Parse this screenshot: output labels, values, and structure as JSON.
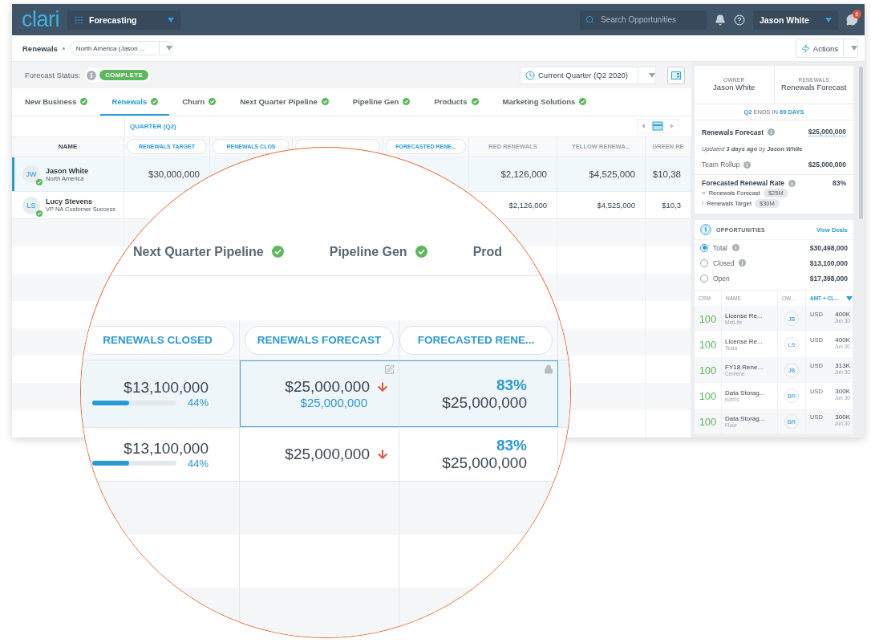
{
  "app": {
    "logo": "clari",
    "module": "Forecasting",
    "search": {
      "placeholder": "Search Opportunities"
    },
    "user": "Jason White",
    "notifications": "6"
  },
  "toolbar": {
    "title": "Renewals",
    "scope": "North America (Jason ...",
    "actions": "Actions"
  },
  "status": {
    "label": "Forecast Status:",
    "badge": "COMPLETE",
    "period": "Current Quarter (Q2 2020)"
  },
  "tabs": [
    {
      "label": "New Business",
      "selected": false,
      "complete": true
    },
    {
      "label": "Renewals",
      "selected": true,
      "complete": true
    },
    {
      "label": "Churn",
      "selected": false,
      "complete": true
    },
    {
      "label": "Next Quarter Pipeline",
      "selected": false,
      "complete": true
    },
    {
      "label": "Pipeline Gen",
      "selected": false,
      "complete": true
    },
    {
      "label": "Products",
      "selected": false,
      "complete": true
    },
    {
      "label": "Marketing Solutions",
      "selected": false,
      "complete": true
    }
  ],
  "table": {
    "group": "QUARTER (Q2)",
    "name_header": "NAME",
    "columns": [
      {
        "kind": "pill",
        "label": "RENEWALS TARGET"
      },
      {
        "kind": "pill",
        "label": "RENEWALS CLOS"
      },
      {
        "kind": "pill"
      },
      {
        "kind": "pill",
        "label": "FORECASTED RENE..."
      },
      {
        "kind": "plain",
        "label": "RED RENEWALS"
      },
      {
        "kind": "plain",
        "label": "YELLOW RENEWA..."
      },
      {
        "kind": "plain",
        "label": "GREEN RE"
      }
    ],
    "rows": [
      {
        "initials": "JW",
        "name": "Jason White",
        "subtitle": "North America",
        "selected": true,
        "cells": [
          "$30,000,000",
          null,
          null,
          null,
          "$2,126,000",
          "$4,525,000",
          "$10,38"
        ]
      },
      {
        "initials": "LS",
        "name": "Lucy Stevens",
        "subtitle": "VP NA Customer Success",
        "selected": false,
        "cells": [
          null,
          null,
          null,
          null,
          "$2,126,000",
          "$4,525,000",
          "$10,3"
        ]
      }
    ]
  },
  "magnifier": {
    "tabs": [
      {
        "label": "Next Quarter Pipeline",
        "complete": true
      },
      {
        "label": "Pipeline Gen",
        "complete": true
      },
      {
        "label": "Prod",
        "complete": false
      }
    ],
    "columns": [
      "RENEWALS CLOSED",
      "RENEWALS FORECAST",
      "FORECASTED RENE..."
    ],
    "rows": [
      {
        "selected": true,
        "closed": "$13,100,000",
        "level": 0.44,
        "pct": "44%",
        "forecast": "$25,000,000",
        "falling": true,
        "forecast_sub": "$25,000,000",
        "rate": "83%",
        "rate_sub": "$25,000,000"
      },
      {
        "selected": false,
        "closed": "$13,100,000",
        "level": 0.44,
        "pct": "44%",
        "forecast": "$25,000,000",
        "falling": true,
        "rate": "83%",
        "rate_sub": "$25,000,000"
      }
    ]
  },
  "summary": {
    "owner_label": "OWNER",
    "owner": "Jason White",
    "type_label": "RENEWALS",
    "type": "Renewals Forecast",
    "countdown": "**Q2** ENDS IN **69 DAYS**",
    "forecast_label": "Renewals Forecast",
    "forecast": "$25,000,000",
    "updated": "Updated **3 days ago** by **Jason White**",
    "rollup_label": "Team Rollup",
    "rollup": "$25,000,000",
    "rate_label": "Forecasted Renewal Rate",
    "rate": "83%",
    "terms": [
      {
        "kind": "equals",
        "op": "=",
        "label": "Renewals Forecast",
        "chip": "$25M"
      },
      {
        "kind": "divide",
        "op": "/",
        "label": "Renewals Target",
        "chip": "$30M"
      }
    ]
  },
  "opportunities": {
    "title": "OPPORTUNITIES",
    "link": "View Deals",
    "filters": [
      {
        "label": "Total",
        "info": true,
        "value": "$30,498,000",
        "selected": true
      },
      {
        "label": "Closed",
        "info": true,
        "value": "$13,100,000",
        "selected": false
      },
      {
        "label": "Open",
        "value": "$17,398,000",
        "selected": false
      }
    ],
    "columns": [
      "CRM",
      "NAME",
      "OW...",
      "AMT + CL..."
    ],
    "deals": [
      {
        "score": "100",
        "name": "License Re...",
        "account": "MetLife",
        "owner": "JB",
        "currency": "USD",
        "amount": "400K",
        "date": "Jun 30"
      },
      {
        "score": "100",
        "name": "License Re...",
        "account": "Tesla",
        "owner": "LS",
        "currency": "USD",
        "amount": "400K",
        "date": "Jun 30"
      },
      {
        "score": "100",
        "name": "FY18 Rene...",
        "account": "Centene",
        "owner": "JB",
        "currency": "USD",
        "amount": "313K",
        "date": "Jun 30"
      },
      {
        "score": "100",
        "name": "Data Storag...",
        "account": "Kohl's",
        "owner": "BR",
        "currency": "USD",
        "amount": "300K",
        "date": "Jun 30"
      },
      {
        "score": "100",
        "name": "Data Storag...",
        "account": "Fluor",
        "owner": "BR",
        "currency": "USD",
        "amount": "300K",
        "date": "Jun 30"
      }
    ]
  }
}
